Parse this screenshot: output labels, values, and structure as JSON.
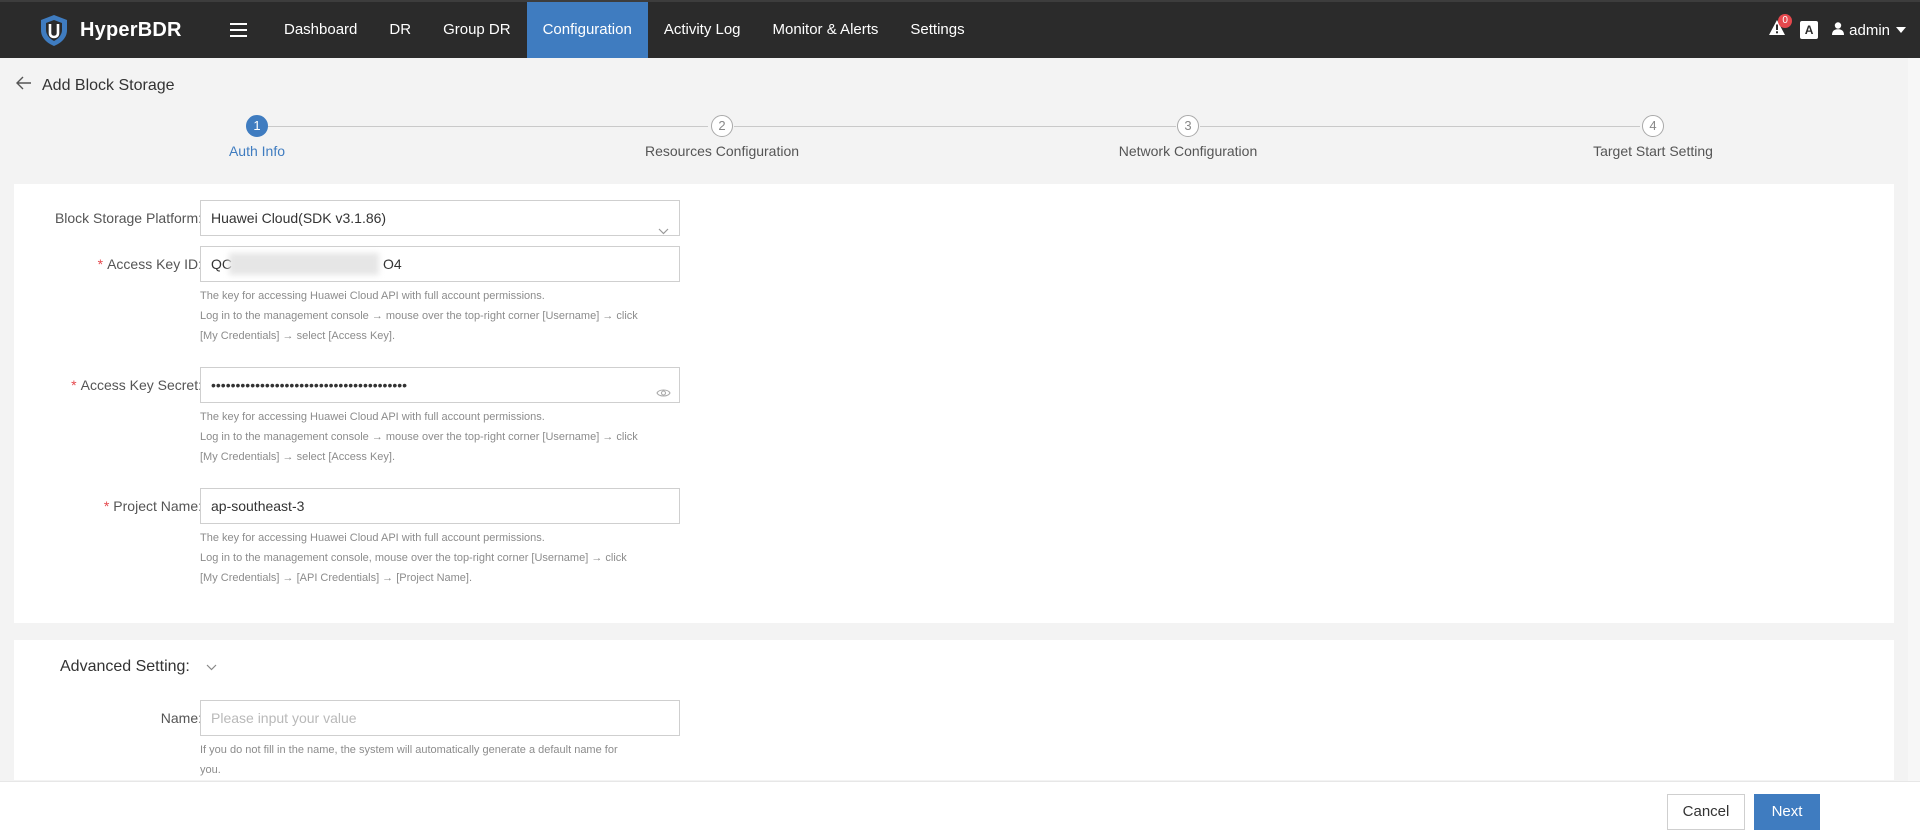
{
  "app": {
    "name": "HyperBDR"
  },
  "nav": {
    "items": [
      {
        "label": "Dashboard",
        "active": false
      },
      {
        "label": "DR",
        "active": false
      },
      {
        "label": "Group DR",
        "active": false
      },
      {
        "label": "Configuration",
        "active": true
      },
      {
        "label": "Activity Log",
        "active": false
      },
      {
        "label": "Monitor & Alerts",
        "active": false
      },
      {
        "label": "Settings",
        "active": false
      }
    ],
    "alert_count": "0",
    "lang_glyph": "A",
    "user": "admin"
  },
  "page": {
    "title": "Add Block Storage"
  },
  "steps": [
    {
      "num": "1",
      "label": "Auth Info",
      "active": true
    },
    {
      "num": "2",
      "label": "Resources Configuration",
      "active": false
    },
    {
      "num": "3",
      "label": "Network Configuration",
      "active": false
    },
    {
      "num": "4",
      "label": "Target Start Setting",
      "active": false
    }
  ],
  "form": {
    "platform": {
      "label": "Block Storage Platform:",
      "value": "Huawei Cloud(SDK v3.1.86)"
    },
    "access_key_id": {
      "label": "Access Key ID:",
      "value_start": "QC",
      "value_end": "O4",
      "help": [
        "The key for accessing Huawei Cloud API with full account permissions.",
        "Log in to the management console → mouse over the top-right corner [Username] → click",
        "[My Credentials] → select [Access Key]."
      ]
    },
    "access_key_secret": {
      "label": "Access Key Secret:",
      "value": "••••••••••••••••••••••••••••••••••••••••",
      "help": [
        "The key for accessing Huawei Cloud API with full account permissions.",
        "Log in to the management console → mouse over the top-right corner [Username] → click",
        "[My Credentials] → select [Access Key]."
      ]
    },
    "project_name": {
      "label": "Project Name:",
      "value": "ap-southeast-3",
      "help": [
        "The key for accessing Huawei Cloud API with full account permissions.",
        "Log in to the management console, mouse over the top-right corner [Username] → click",
        "[My Credentials] → [API Credentials] → [Project Name]."
      ]
    }
  },
  "advanced": {
    "title": "Advanced Setting:",
    "name": {
      "label": "Name:",
      "placeholder": "Please input your value",
      "help": [
        "If you do not fill in the name, the system will automatically generate a default name for",
        "you."
      ]
    }
  },
  "footer": {
    "cancel": "Cancel",
    "next": "Next"
  },
  "colors": {
    "accent": "#3f7cc0",
    "topbar": "#2b2b2b",
    "required": "#e5484d"
  }
}
